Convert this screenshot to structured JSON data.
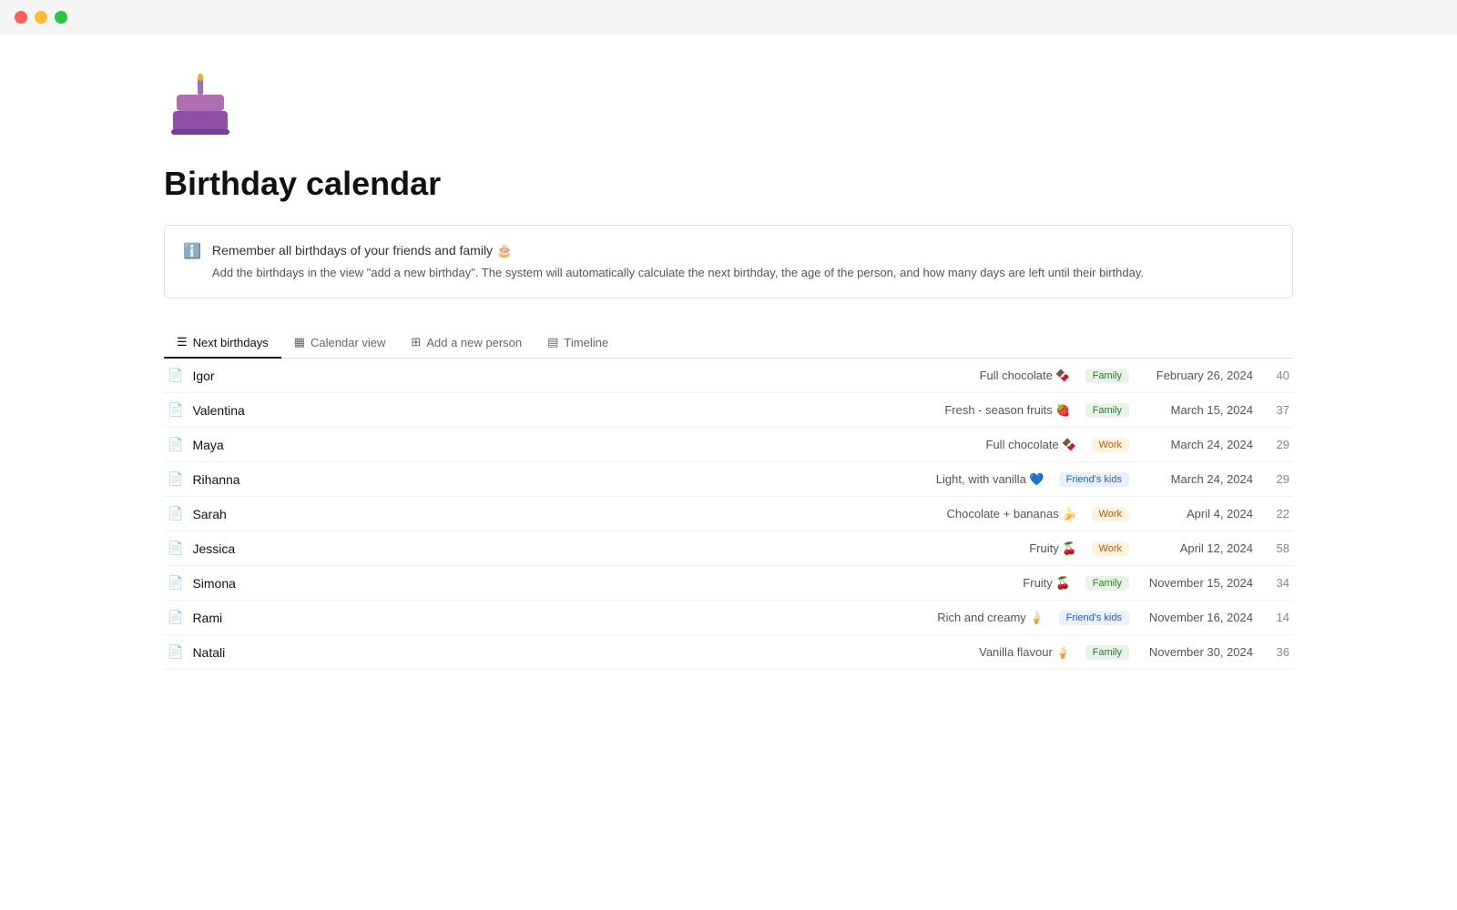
{
  "titlebar": {
    "btn_close": "close",
    "btn_minimize": "minimize",
    "btn_maximize": "maximize"
  },
  "page": {
    "title": "Birthday calendar",
    "info_line1": "Remember all birthdays of your friends and family 🎂",
    "info_line2": "Add the birthdays in the view \"add a new birthday\". The system will automatically calculate the next birthday, the age of the person, and how many days are left until their birthday."
  },
  "tabs": [
    {
      "id": "next-birthdays",
      "label": "Next birthdays",
      "icon": "list",
      "active": true
    },
    {
      "id": "calendar-view",
      "label": "Calendar view",
      "icon": "calendar",
      "active": false
    },
    {
      "id": "add-person",
      "label": "Add a new person",
      "icon": "table",
      "active": false
    },
    {
      "id": "timeline",
      "label": "Timeline",
      "icon": "timeline",
      "active": false
    }
  ],
  "rows": [
    {
      "name": "Igor",
      "flavor": "Full chocolate 🍫",
      "tag": "Family",
      "tag_type": "family",
      "date": "February 26, 2024",
      "age": "40"
    },
    {
      "name": "Valentina",
      "flavor": "Fresh - season fruits 🍓",
      "tag": "Family",
      "tag_type": "family",
      "date": "March 15, 2024",
      "age": "37"
    },
    {
      "name": "Maya",
      "flavor": "Full chocolate 🍫",
      "tag": "Work",
      "tag_type": "work",
      "date": "March 24, 2024",
      "age": "29"
    },
    {
      "name": "Rihanna",
      "flavor": "Light, with vanilla 💙",
      "tag": "Friend's kids",
      "tag_type": "friends-kids",
      "date": "March 24, 2024",
      "age": "29"
    },
    {
      "name": "Sarah",
      "flavor": "Chocolate + bananas 🍌",
      "tag": "Work",
      "tag_type": "work",
      "date": "April 4, 2024",
      "age": "22"
    },
    {
      "name": "Jessica",
      "flavor": "Fruity 🍒",
      "tag": "Work",
      "tag_type": "work",
      "date": "April 12, 2024",
      "age": "58"
    },
    {
      "name": "Simona",
      "flavor": "Fruity 🍒",
      "tag": "Family",
      "tag_type": "family",
      "date": "November 15, 2024",
      "age": "34"
    },
    {
      "name": "Rami",
      "flavor": "Rich and creamy 🍦",
      "tag": "Friend's kids",
      "tag_type": "friends-kids",
      "date": "November 16, 2024",
      "age": "14"
    },
    {
      "name": "Natali",
      "flavor": "Vanilla flavour 🍦",
      "tag": "Family",
      "tag_type": "family",
      "date": "November 30, 2024",
      "age": "36"
    }
  ]
}
